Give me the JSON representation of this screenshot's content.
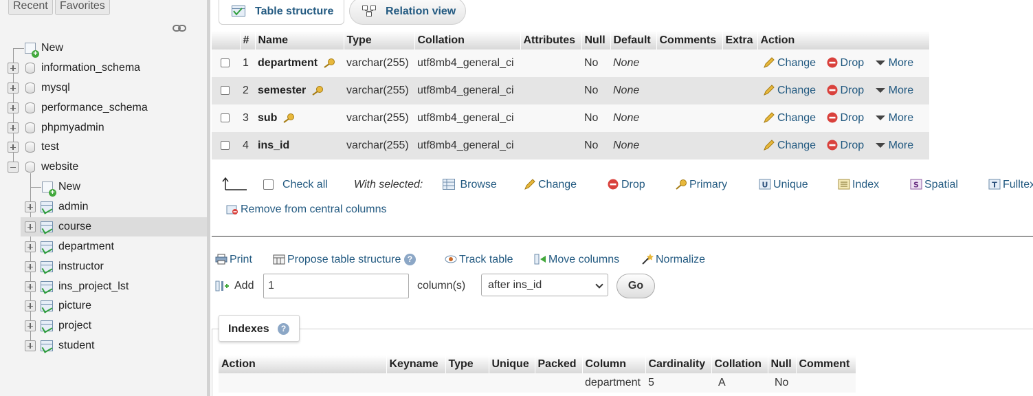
{
  "nav": {
    "tabs": [
      "Recent",
      "Favorites"
    ],
    "tree": {
      "new_label": "New",
      "databases": [
        "information_schema",
        "mysql",
        "performance_schema",
        "phpmyadmin",
        "test",
        "website"
      ],
      "website_children": {
        "new_label": "New",
        "tables": [
          "admin",
          "course",
          "department",
          "instructor",
          "ins_project_lst",
          "picture",
          "project",
          "student"
        ]
      }
    }
  },
  "tabs": {
    "structure": "Table structure",
    "relation": "Relation view"
  },
  "structure": {
    "headers": [
      "#",
      "Name",
      "Type",
      "Collation",
      "Attributes",
      "Null",
      "Default",
      "Comments",
      "Extra",
      "Action"
    ],
    "rows": [
      {
        "num": "1",
        "name": "department",
        "type": "varchar(255)",
        "collation": "utf8mb4_general_ci",
        "null": "No",
        "default": "None",
        "has_key": true
      },
      {
        "num": "2",
        "name": "semester",
        "type": "varchar(255)",
        "collation": "utf8mb4_general_ci",
        "null": "No",
        "default": "None",
        "has_key": true
      },
      {
        "num": "3",
        "name": "sub",
        "type": "varchar(255)",
        "collation": "utf8mb4_general_ci",
        "null": "No",
        "default": "None",
        "has_key": true
      },
      {
        "num": "4",
        "name": "ins_id",
        "type": "varchar(255)",
        "collation": "utf8mb4_general_ci",
        "null": "No",
        "default": "None",
        "has_key": false
      }
    ],
    "row_actions": {
      "change": "Change",
      "drop": "Drop",
      "more": "More"
    }
  },
  "bulk": {
    "check_all": "Check all",
    "with_selected": "With selected:",
    "browse": "Browse",
    "change": "Change",
    "drop": "Drop",
    "primary": "Primary",
    "unique": "Unique",
    "index": "Index",
    "spatial": "Spatial",
    "fulltext": "Fulltext",
    "remove_central": "Remove from central columns"
  },
  "tools": {
    "print": "Print",
    "propose": "Propose table structure",
    "track": "Track table",
    "move": "Move columns",
    "normalize": "Normalize"
  },
  "add": {
    "label": "Add",
    "count": "1",
    "unit": "column(s)",
    "position": "after ins_id",
    "go": "Go"
  },
  "indexes": {
    "title": "Indexes",
    "headers": [
      "Action",
      "Keyname",
      "Type",
      "Unique",
      "Packed",
      "Column",
      "Cardinality",
      "Collation",
      "Null",
      "Comment"
    ],
    "row": {
      "action": "",
      "keyname": "",
      "type": "",
      "unique": "",
      "packed": "",
      "column": "department",
      "cardinality": "5",
      "collation": "A",
      "null": "No",
      "comment": ""
    }
  }
}
